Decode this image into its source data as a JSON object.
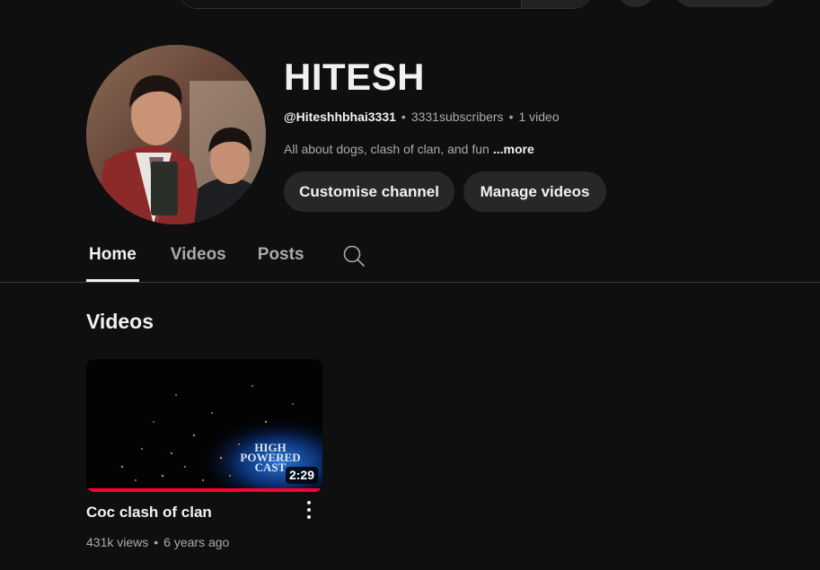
{
  "colors": {
    "background": "#0f0f0f",
    "text_primary": "#f1f1f1",
    "text_secondary": "#aaaaaa",
    "button_bg": "#272727",
    "progress_red": "#ff0033"
  },
  "channel": {
    "name": "HITESH",
    "handle": "@Hiteshhbhai3331",
    "subscribers": "3331subscribers",
    "video_count": "1 video",
    "separator": "•",
    "description": "All about dogs, clash of clan, and fun",
    "more_label": "...more",
    "avatar_icon": "channel-avatar-photo"
  },
  "buttons": {
    "customise": "Customise channel",
    "manage": "Manage videos"
  },
  "tabs": [
    {
      "label": "Home",
      "active": true
    },
    {
      "label": "Videos",
      "active": false
    },
    {
      "label": "Posts",
      "active": false
    }
  ],
  "tab_search_icon": "search-icon",
  "section": {
    "title": "Videos"
  },
  "video": {
    "title": "Coc clash of clan",
    "views": "431k views",
    "age": "6 years ago",
    "separator": "•",
    "duration": "2:29",
    "watched_fraction": 1.0,
    "thumbnail_text": [
      "HIGH",
      "POWERED",
      "CAST"
    ],
    "menu_icon": "more-vert-icon"
  }
}
